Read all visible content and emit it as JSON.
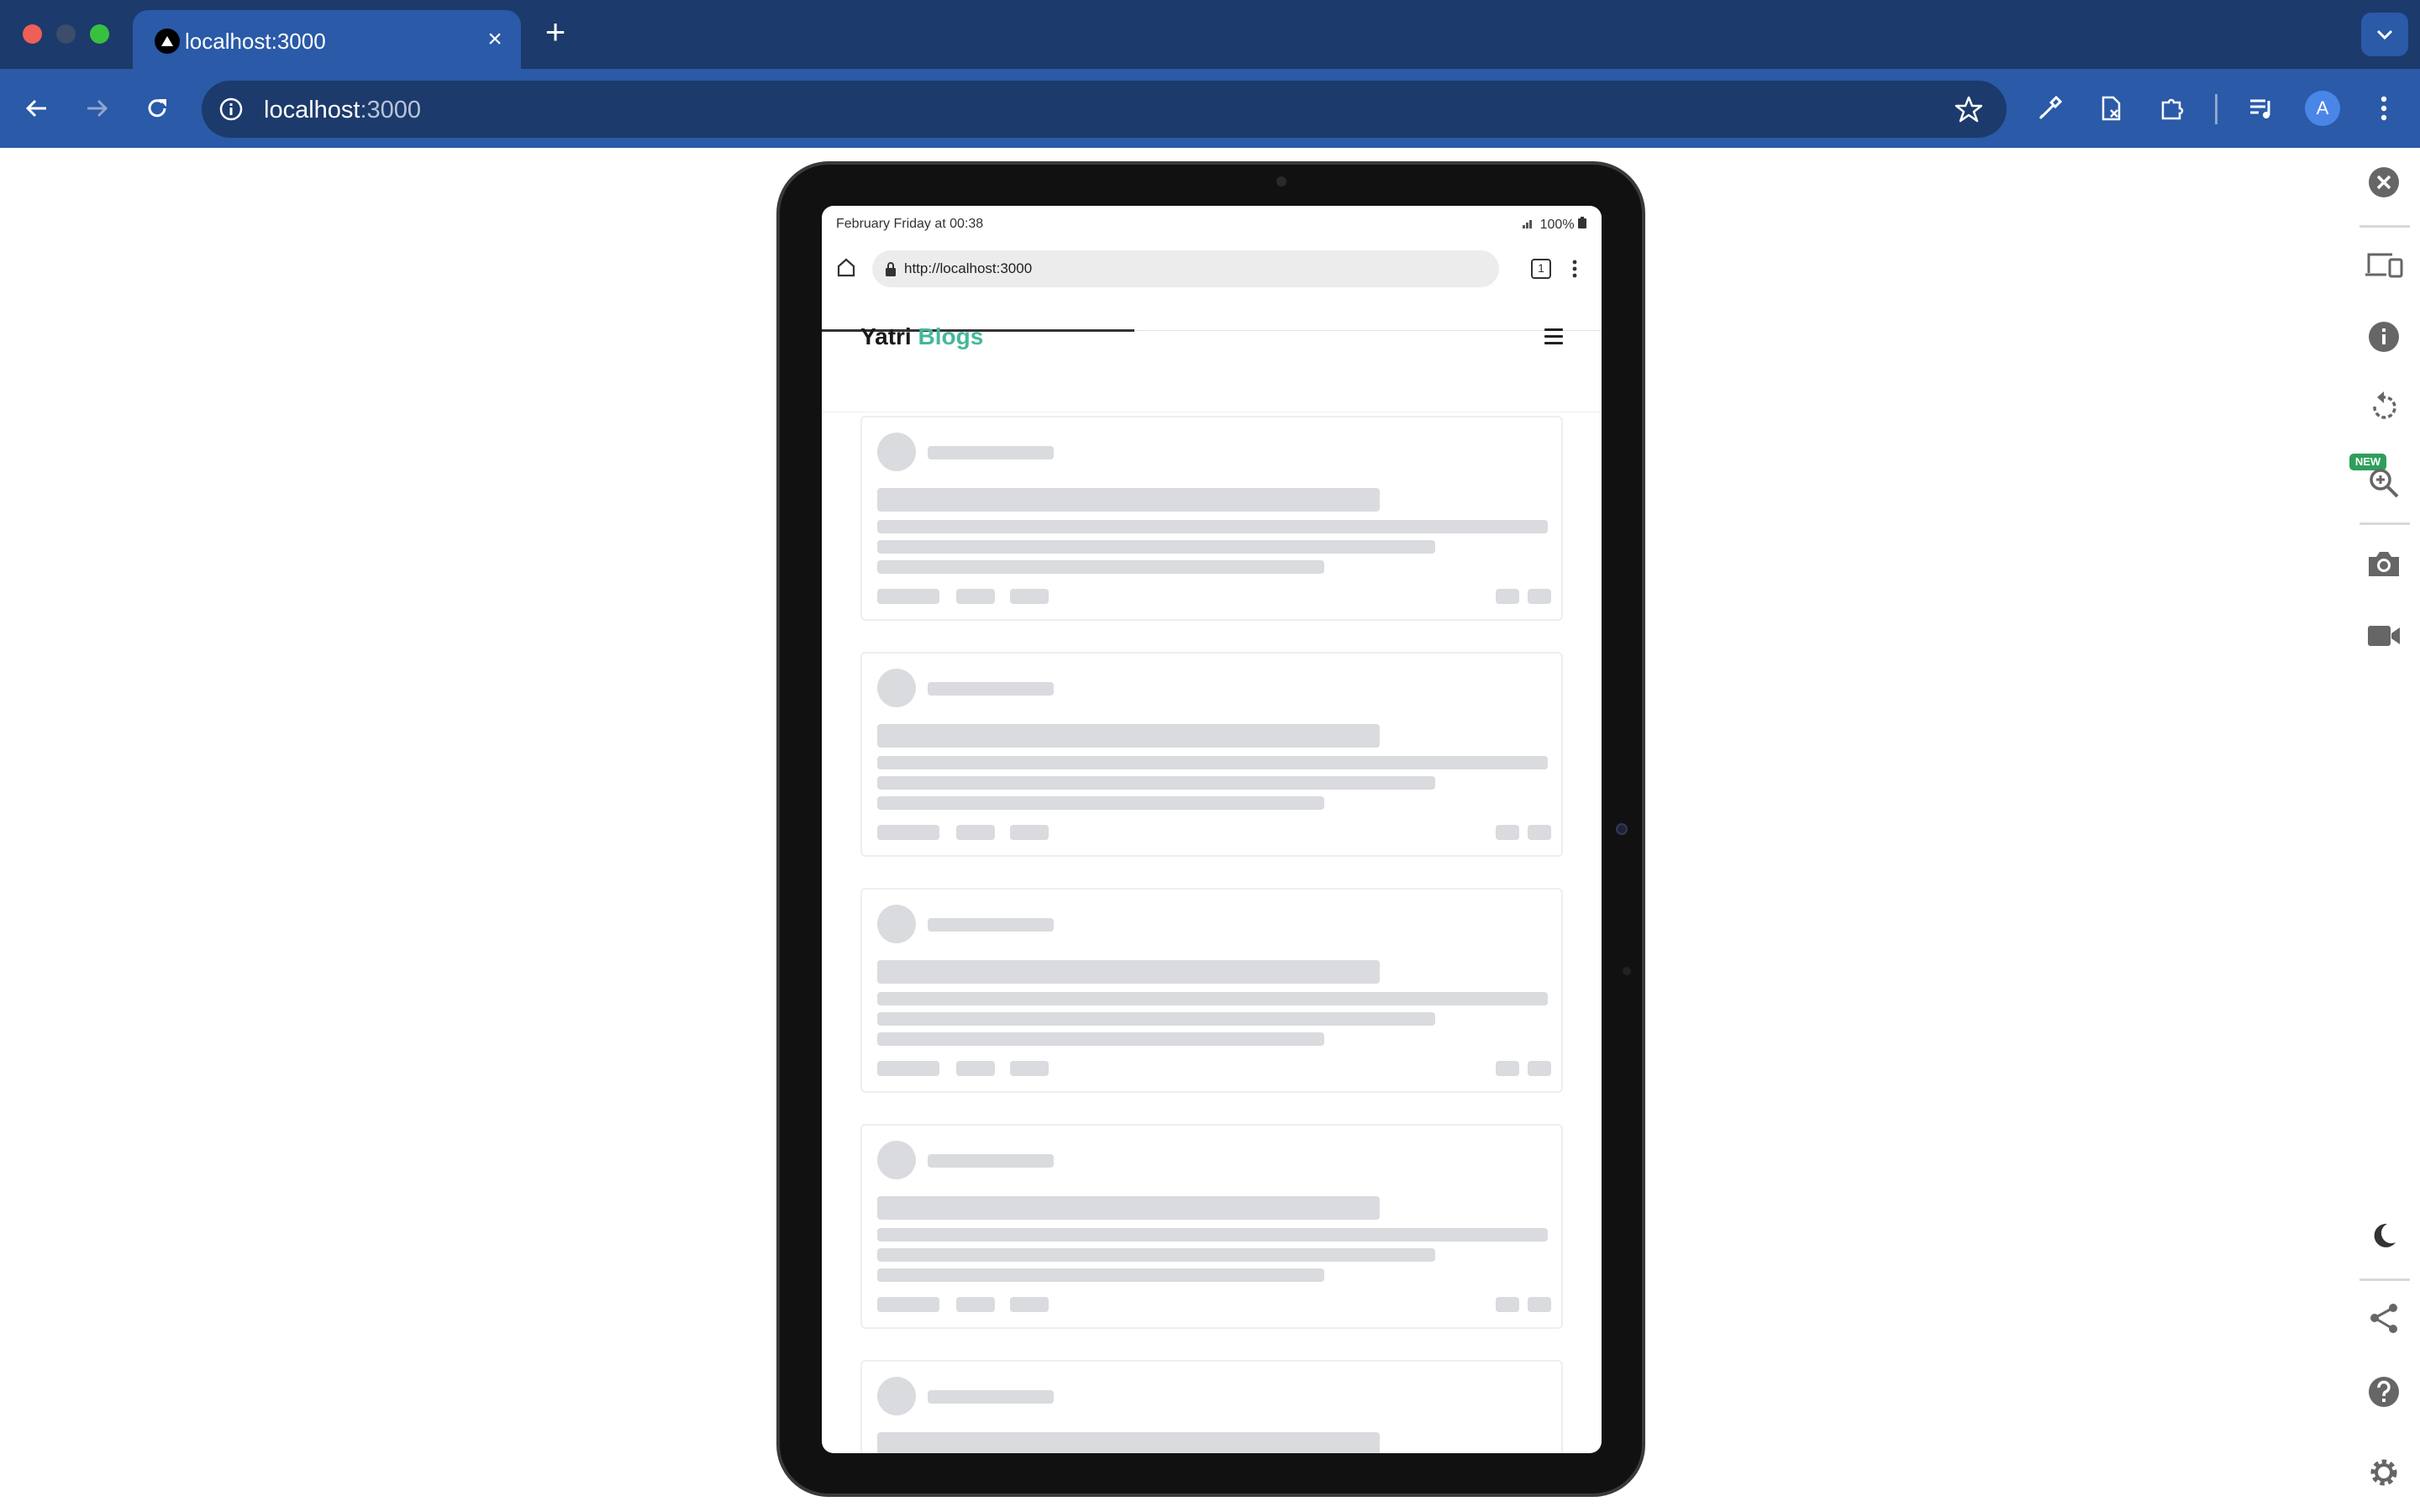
{
  "browser": {
    "tab_title": "localhost:3000",
    "tab_close": "×",
    "new_tab": "+",
    "url_host": "localhost",
    "url_port": ":3000",
    "profile_initial": "A"
  },
  "device": {
    "status_time": "February Friday at 00:38",
    "status_battery": "100%",
    "url": "http://localhost:3000",
    "tab_count": "1"
  },
  "site": {
    "logo_main": "Yatri",
    "logo_accent": "Blogs",
    "accent_color": "#44b89a"
  },
  "loading_cards": [
    {
      "state": "skeleton"
    },
    {
      "state": "skeleton"
    },
    {
      "state": "skeleton"
    },
    {
      "state": "skeleton"
    },
    {
      "state": "skeleton"
    }
  ],
  "sidebar_tools": {
    "new_badge": "NEW",
    "icons": [
      "close-icon",
      "devices-icon",
      "info-icon",
      "rotate-icon",
      "zoom-icon",
      "camera-icon",
      "video-icon",
      "moon-icon",
      "share-icon",
      "help-icon",
      "settings-icon"
    ]
  },
  "colors": {
    "chrome_dark": "#1c3a6b",
    "chrome": "#2a5aa8",
    "skeleton": "#d9dbde"
  }
}
